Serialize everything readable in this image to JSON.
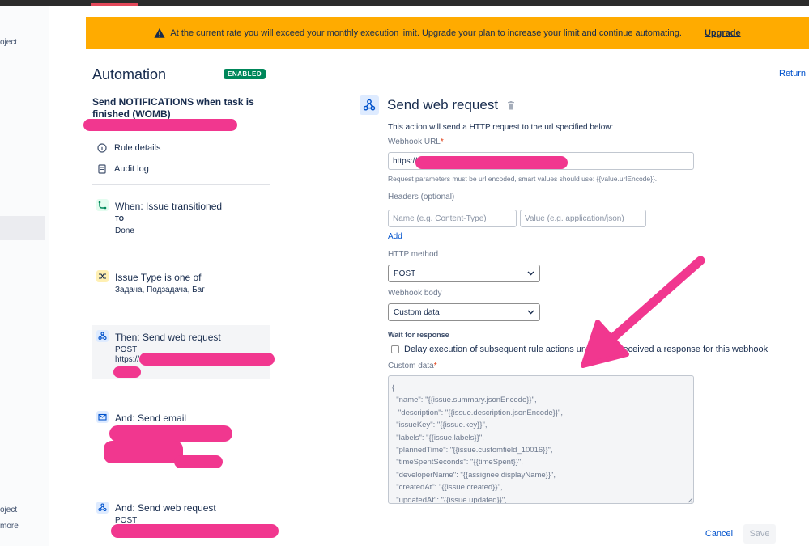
{
  "left_nav": {
    "item_top": "oject",
    "item_bottom_1": "oject",
    "item_bottom_2": "more"
  },
  "banner": {
    "message": "At the current rate you will exceed your monthly execution limit. Upgrade your plan to increase your limit and continue automating.",
    "link_label": "Upgrade",
    "color": "#ffab00"
  },
  "header": {
    "title": "Automation",
    "status_badge": "ENABLED",
    "return_label": "Return"
  },
  "rule": {
    "title": "Send NOTIFICATIONS when task is finished (WOMB)",
    "links": [
      {
        "label": "Rule details",
        "icon": "info-icon"
      },
      {
        "label": "Audit log",
        "icon": "document-icon"
      }
    ]
  },
  "steps": [
    {
      "title": "When: Issue transitioned",
      "sub_label": "TO",
      "sub_value": "Done",
      "icon": "transition-icon"
    },
    {
      "title": "Issue Type is one of",
      "sub_value": "Задача, Подзадача, Баг",
      "icon": "shuffle-icon"
    },
    {
      "title": "Then: Send web request",
      "method": "POST",
      "url": "https://",
      "icon": "webhook-icon"
    },
    {
      "title": "And: Send email",
      "icon": "email-icon"
    },
    {
      "title": "And: Send web request",
      "method": "POST",
      "icon": "webhook-icon"
    }
  ],
  "panel": {
    "title": "Send web request",
    "description": "This action will send a HTTP request to the url specified below:",
    "webhook_url_label": "Webhook URL",
    "webhook_url_value": "https://",
    "url_help": "Request parameters must be url encoded, smart values should use: {{value.urlEncode}}.",
    "headers_label": "Headers (optional)",
    "header_name_placeholder": "Name (e.g. Content-Type)",
    "header_value_placeholder": "Value (e.g. application/json)",
    "add_label": "Add",
    "http_method_label": "HTTP method",
    "http_method_value": "POST",
    "webhook_body_label": "Webhook body",
    "webhook_body_value": "Custom data",
    "wait_label": "Wait for response",
    "delay_label": "Delay execution of subsequent rule actions until we've received a response for this webhook",
    "custom_data_label": "Custom data",
    "custom_data_value": "{\n  \"name\": \"{{issue.summary.jsonEncode}}\",\n   \"description\": \"{{issue.description.jsonEncode}}\",\n  \"issueKey\": \"{{issue.key}}\",\n  \"labels\": \"{{issue.labels}}\",\n  \"plannedTime\": \"{{issue.customfield_10016}}\",\n  \"timeSpentSeconds\": \"{{timeSpent}}\",\n  \"developerName\": \"{{assignee.displayName}}\",\n  \"createdAt\": \"{{issue.created}}\",\n  \"updatedAt\": \"{{issue.updated}}\","
  },
  "footer": {
    "cancel_label": "Cancel",
    "save_label": "Save"
  }
}
